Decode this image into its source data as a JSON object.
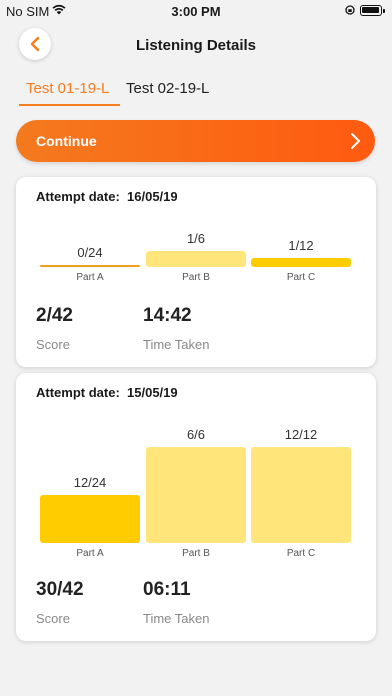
{
  "status_bar": {
    "carrier": "No SIM",
    "time": "3:00 PM"
  },
  "header": {
    "title": "Listening Details"
  },
  "tabs": [
    {
      "label": "Test 01-19-L",
      "active": true
    },
    {
      "label": "Test 02-19-L",
      "active": false
    }
  ],
  "continue_button": {
    "label": "Continue"
  },
  "attempts": [
    {
      "date_label": "Attempt date:",
      "date": "16/05/19",
      "parts": [
        {
          "name": "Part A",
          "score": "0/24",
          "fraction": 0
        },
        {
          "name": "Part B",
          "score": "1/6",
          "fraction": 0.1667
        },
        {
          "name": "Part C",
          "score": "1/12",
          "fraction": 0.0833
        }
      ],
      "score": "2/42",
      "score_label": "Score",
      "time": "14:42",
      "time_label": "Time Taken"
    },
    {
      "date_label": "Attempt date:",
      "date": "15/05/19",
      "parts": [
        {
          "name": "Part A",
          "score": "12/24",
          "fraction": 0.5
        },
        {
          "name": "Part B",
          "score": "6/6",
          "fraction": 1
        },
        {
          "name": "Part C",
          "score": "12/12",
          "fraction": 1
        }
      ],
      "score": "30/42",
      "score_label": "Score",
      "time": "06:11",
      "time_label": "Time Taken"
    }
  ],
  "colors": {
    "accent": "#f57c1f",
    "bar_light": "#ffe57a",
    "bar_dark": "#ffcc00"
  }
}
